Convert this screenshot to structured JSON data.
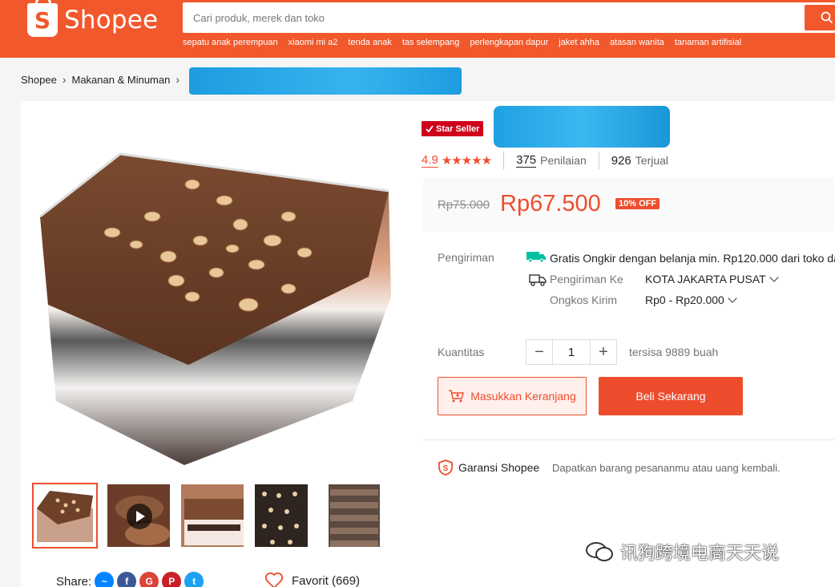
{
  "header": {
    "logo_text": "Shopee",
    "logo_glyph": "S",
    "search_placeholder": "Cari produk, merek dan toko",
    "suggestions": [
      "sepatu anak perempuan",
      "xiaomi mi a2",
      "tenda anak",
      "tas selempang",
      "perlengkapan dapur",
      "jaket ahha",
      "atasan wanita",
      "tanaman artifisial"
    ]
  },
  "breadcrumb": [
    "Shopee",
    "Makanan & Minuman"
  ],
  "product": {
    "badge": "Star Seller",
    "rating": "4.9",
    "stars": "★★★★★",
    "reviews_count": "375",
    "reviews_label": "Penilaian",
    "sold_count": "926",
    "sold_label": "Terjual",
    "price_old": "Rp75.000",
    "price_new": "Rp67.500",
    "discount": "10% OFF"
  },
  "shipping": {
    "label": "Pengiriman",
    "free_text": "Gratis Ongkir dengan belanja min. Rp120.000 dari toko da",
    "to_label": "Pengiriman Ke",
    "to_value": "KOTA JAKARTA PUSAT",
    "cost_label": "Ongkos Kirim",
    "cost_value": "Rp0 - Rp20.000"
  },
  "quantity": {
    "label": "Kuantitas",
    "value": "1",
    "minus": "−",
    "plus": "+",
    "stock": "tersisa 9889 buah"
  },
  "actions": {
    "cart": "Masukkan Keranjang",
    "buy": "Beli Sekarang"
  },
  "guarantee": {
    "title": "Garansi Shopee",
    "desc": "Dapatkan barang pesananmu atau uang kembali."
  },
  "share": {
    "label": "Share:",
    "favorite": "Favorit (669)"
  },
  "watermark": "讯狗跨境电商天天说",
  "colors": {
    "brand": "#ee4d2d",
    "header": "#f1582c"
  }
}
